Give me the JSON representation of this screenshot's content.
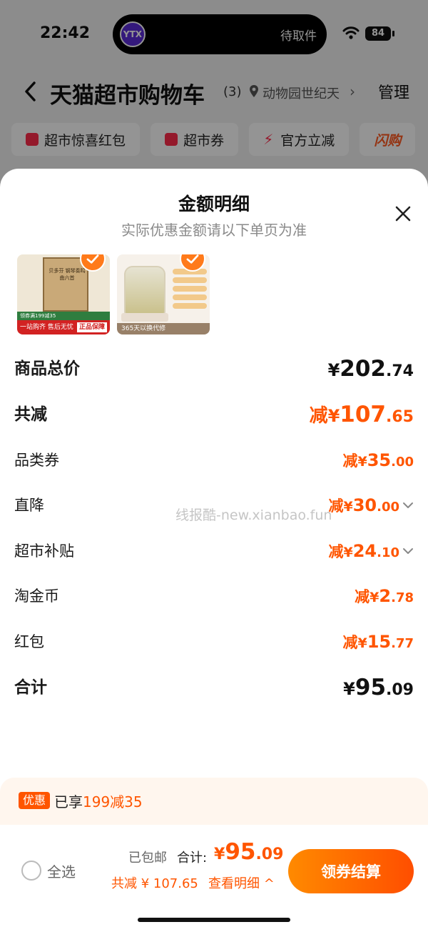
{
  "status_bar": {
    "time": "22:42",
    "island_text": "待取件",
    "island_logo": "YTX",
    "battery": "84"
  },
  "nav": {
    "title": "天猫超市购物车",
    "count": "(3)",
    "location": "动物园世纪天",
    "arrow": "›",
    "manage": "管理"
  },
  "chips": [
    {
      "label": "超市惊喜红包",
      "icon": "red-packet-icon"
    },
    {
      "label": "超市券",
      "icon": "coupon-icon"
    },
    {
      "label": "官方立减",
      "icon": "bolt-icon"
    },
    {
      "label": "闪购"
    }
  ],
  "sheet": {
    "title": "金额明细",
    "subtitle": "实际优惠金额请以下单页为准",
    "thumbs": {
      "book_title": "贝多芬 钢琴奏鸣曲六首",
      "book_band": "领券满199减35",
      "book_bottom": "一站购齐 售后无忧",
      "book_badge": "正品保障",
      "kettle_band": "365天以换代修"
    },
    "rows": [
      {
        "label": "商品总价",
        "prefix": "",
        "yen": "¥",
        "int": "202",
        "dec": ".74"
      },
      {
        "label": "共减",
        "prefix": "减",
        "yen": "¥",
        "int": "107",
        "dec": ".65"
      },
      {
        "label": "品类券",
        "prefix": "减",
        "yen": "¥",
        "int": "35",
        "dec": ".00"
      },
      {
        "label": "直降",
        "prefix": "减",
        "yen": "¥",
        "int": "30",
        "dec": ".00"
      },
      {
        "label": "超市补贴",
        "prefix": "减",
        "yen": "¥",
        "int": "24",
        "dec": ".10"
      },
      {
        "label": "淘金币",
        "prefix": "减",
        "yen": "¥",
        "int": "2",
        "dec": ".78"
      },
      {
        "label": "红包",
        "prefix": "减",
        "yen": "¥",
        "int": "15",
        "dec": ".77"
      },
      {
        "label": "合计",
        "prefix": "",
        "yen": "¥",
        "int": "95",
        "dec": ".09"
      }
    ],
    "watermark": "线报酷-new.xianbao.fun"
  },
  "promo": {
    "tag": "优惠",
    "text_prefix": "已享",
    "text_highlight": "199减35"
  },
  "bottom": {
    "select_all": "全选",
    "shipping": "已包邮",
    "total_label": "合计:",
    "total_yen": "¥",
    "total_int": "95",
    "total_dec": ".09",
    "saved": "共减 ¥ 107.65",
    "detail_link": "查看明细 ^",
    "checkout": "领券结算"
  },
  "colors": {
    "accent": "#ff5500",
    "button_start": "#ff8a00",
    "button_end": "#ff4e00",
    "promo_bg": "#fff6ee"
  }
}
